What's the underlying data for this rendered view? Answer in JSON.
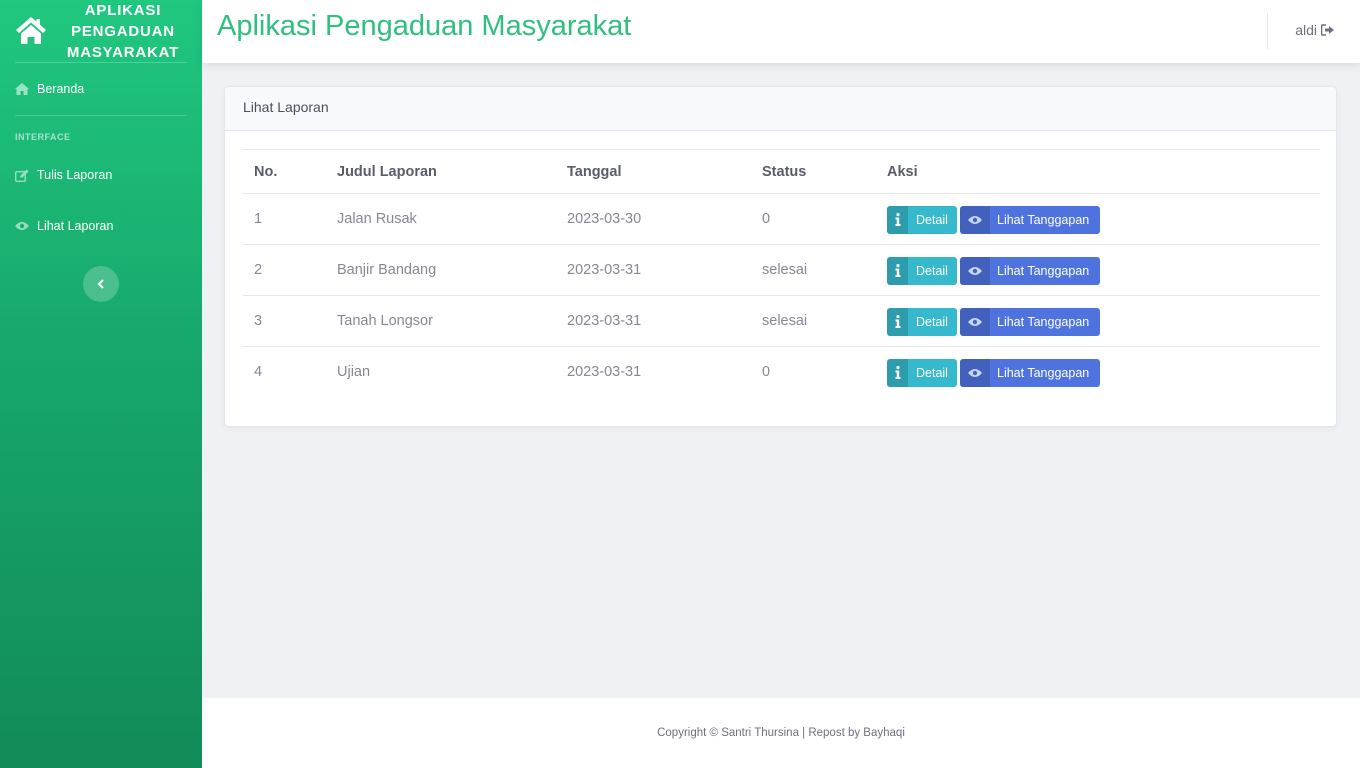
{
  "sidebar": {
    "brand": [
      "APLIKASI",
      "PENGADUAN",
      "MASYARAKAT"
    ],
    "items": [
      {
        "label": "Beranda",
        "icon": "home-icon"
      },
      {
        "label": "Tulis Laporan",
        "icon": "edit-icon"
      },
      {
        "label": "Lihat Laporan",
        "icon": "eye-icon"
      }
    ],
    "heading": "INTERFACE",
    "toggle_icon": "chevron-left-icon"
  },
  "header": {
    "title": "Aplikasi Pengaduan Masyarakat",
    "user": "aldi",
    "user_icon": "sign-out-icon"
  },
  "card": {
    "title": "Lihat Laporan",
    "columns": [
      "No.",
      "Judul Laporan",
      "Tanggal",
      "Status",
      "Aksi"
    ],
    "rows": [
      {
        "no": "1",
        "judul": "Jalan Rusak",
        "tanggal": "2023-03-30",
        "status": "0"
      },
      {
        "no": "2",
        "judul": "Banjir Bandang",
        "tanggal": "2023-03-31",
        "status": "selesai"
      },
      {
        "no": "3",
        "judul": "Tanah Longsor",
        "tanggal": "2023-03-31",
        "status": "selesai"
      },
      {
        "no": "4",
        "judul": "Ujian",
        "tanggal": "2023-03-31",
        "status": "0"
      }
    ],
    "actions": {
      "detail": "Detail",
      "tanggapan": "Lihat Tanggapan"
    }
  },
  "footer": {
    "text": "Copyright © Santri Thursina | Repost by Bayhaqi"
  },
  "colors": {
    "sidebar": "#1cc88a",
    "title": "#2fc07f",
    "info": "#36b9cc",
    "primary": "#4e73df"
  }
}
